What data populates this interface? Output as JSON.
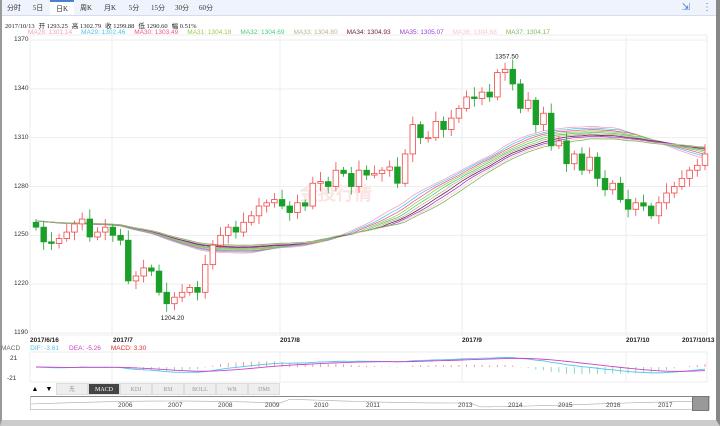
{
  "tabs": [
    "分时",
    "5日",
    "日K",
    "周K",
    "月K",
    "5分",
    "15分",
    "30分",
    "60分"
  ],
  "active_tab": "日K",
  "info": {
    "date": "2017/10/13",
    "open": "开 1293.25",
    "high": "高 1302.79",
    "close": "收 1299.88",
    "low": "低 1290.60",
    "change": "幅 0.51%"
  },
  "ma_legend": [
    {
      "label": "MA28: 1301.14",
      "color": "#f4a0c8"
    },
    {
      "label": "MA29: 1302.46",
      "color": "#4fc6e8"
    },
    {
      "label": "MA30: 1303.49",
      "color": "#f0588c"
    },
    {
      "label": "MA31: 1304.18",
      "color": "#a0cc50"
    },
    {
      "label": "MA32: 1304.69",
      "color": "#50c880"
    },
    {
      "label": "MA33: 1304.80",
      "color": "#c0b090"
    },
    {
      "label": "MA34: 1304.93",
      "color": "#6a2040"
    },
    {
      "label": "MA35: 1305.07",
      "color": "#9a40d0"
    },
    {
      "label": "MA36: 1304.68",
      "color": "#f8c8c8"
    },
    {
      "label": "MA37: 1304.17",
      "color": "#80b860"
    }
  ],
  "y_axis": [
    "1370",
    "1340",
    "1310",
    "1280",
    "1250",
    "1220",
    "1190"
  ],
  "x_axis": [
    "2017/6/16",
    "2017/7",
    "2017/8",
    "2017/9",
    "2017/10",
    "2017/10/13"
  ],
  "annotations": {
    "high": "1357.50",
    "low": "1204.20"
  },
  "watermark": "金投行情",
  "macd": {
    "name": "MACD",
    "dif": "DIF: -3.61",
    "dea": "DEA: -5.26",
    "macd": "MACD: 3.30",
    "upper": "21",
    "lower": "-21"
  },
  "indicator_buttons": [
    "无",
    "MACD",
    "KDJ",
    "RSI",
    "BOLL",
    "WR",
    "DMI"
  ],
  "active_indicator": "MACD",
  "arrows": [
    "▲",
    "▼"
  ],
  "navigator_years": [
    "2006",
    "2007",
    "2008",
    "2009",
    "2010",
    "2011",
    "2013",
    "2014",
    "2015",
    "2016",
    "2017"
  ],
  "colors": {
    "up": "#f04848",
    "down": "#1aa028",
    "dif": "#4fc6e8",
    "dea": "#d040c8"
  },
  "chart_data": {
    "type": "candlestick",
    "ylim": [
      1190,
      1370
    ],
    "first_open": 1258,
    "closes": [
      1255,
      1246,
      1245,
      1248,
      1252,
      1257,
      1260,
      1249,
      1252,
      1255,
      1250,
      1247,
      1222,
      1225,
      1230,
      1228,
      1215,
      1208,
      1212,
      1215,
      1218,
      1215,
      1232,
      1244,
      1250,
      1255,
      1252,
      1258,
      1262,
      1268,
      1270,
      1272,
      1268,
      1264,
      1270,
      1268,
      1282,
      1283,
      1280,
      1290,
      1288,
      1280,
      1290,
      1287,
      1288,
      1290,
      1292,
      1282,
      1300,
      1318,
      1310,
      1310,
      1320,
      1315,
      1322,
      1328,
      1335,
      1334,
      1338,
      1335,
      1350,
      1352,
      1343,
      1328,
      1333,
      1318,
      1325,
      1305,
      1308,
      1294,
      1300,
      1290,
      1298,
      1285,
      1278,
      1282,
      1272,
      1266,
      1270,
      1268,
      1262,
      1270,
      1276,
      1280,
      1285,
      1290,
      1293,
      1300
    ]
  }
}
